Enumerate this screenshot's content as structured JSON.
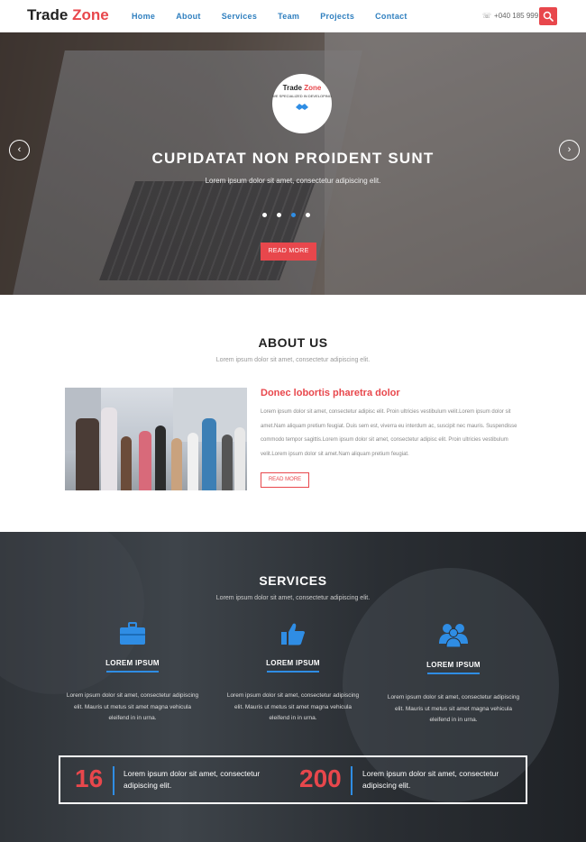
{
  "nav": {
    "brand_main": "Trade",
    "brand_accent": "Zone",
    "menu": [
      "Home",
      "About",
      "Services",
      "Team",
      "Projects",
      "Contact"
    ],
    "phone": "+040 185 999",
    "phone_icon": "phone-icon",
    "search_icon": "search-icon"
  },
  "colors": {
    "accent": "#e8474c",
    "link": "#2f7fbf",
    "blue": "#2f8de4"
  },
  "hero": {
    "logo_main": "Trade",
    "logo_accent": "Zone",
    "logo_tagline": "WE SPECIALIZED IN DEVELOPING",
    "title": "CUPIDATAT NON PROIDENT SUNT",
    "subtitle": "Lorem ipsum dolor sit amet, consectetur adipiscing elit.",
    "button": "READ MORE",
    "slides": 4,
    "active_slide": 3,
    "prev_icon": "chevron-left-icon",
    "next_icon": "chevron-right-icon"
  },
  "about": {
    "title": "ABOUT US",
    "subtitle": "Lorem ipsum dolor sit amet, consectetur adipiscing elit.",
    "heading": "Donec lobortis pharetra dolor",
    "paragraph": "Lorem ipsum dolor sit amet, consectetur adipisc elit. Proin ultricies vestibulum velit.Lorem ipsum dolor sit amet.Nam aliquam pretium feugiat. Duis sem est, viverra eu interdum ac, suscipit nec mauris. Suspendisse commodo tempor sagittis.Lorem ipsum dolor sit amet, consectetur adipisc elit. Proin ultricies vestibulum velit.Lorem ipsum dolor sit amet.Nam aliquam pretium feugiat.",
    "button": "READ MORE"
  },
  "services": {
    "title": "SERVICES",
    "subtitle": "Lorem ipsum dolor sit amet, consectetur adipiscing elit.",
    "items": [
      {
        "icon": "briefcase-icon",
        "name": "LOREM IPSUM",
        "desc": "Lorem ipsum dolor sit amet, consectetur adipiscing elit. Mauris ut metus sit amet magna vehicula eleifend in in urna."
      },
      {
        "icon": "thumbs-up-icon",
        "name": "LOREM IPSUM",
        "desc": "Lorem ipsum dolor sit amet, consectetur adipiscing elit. Mauris ut metus sit amet magna vehicula eleifend in in urna."
      },
      {
        "icon": "users-icon",
        "name": "LOREM IPSUM",
        "desc": "Lorem ipsum dolor sit amet, consectetur adipiscing elit. Mauris ut metus sit amet magna vehicula eleifend in in urna."
      }
    ],
    "stats": [
      {
        "number": "16",
        "text": "Lorem ipsum dolor sit amet, consectetur adipiscing elit."
      },
      {
        "number": "200",
        "text": "Lorem ipsum dolor sit amet, consectetur adipiscing elit."
      }
    ]
  }
}
